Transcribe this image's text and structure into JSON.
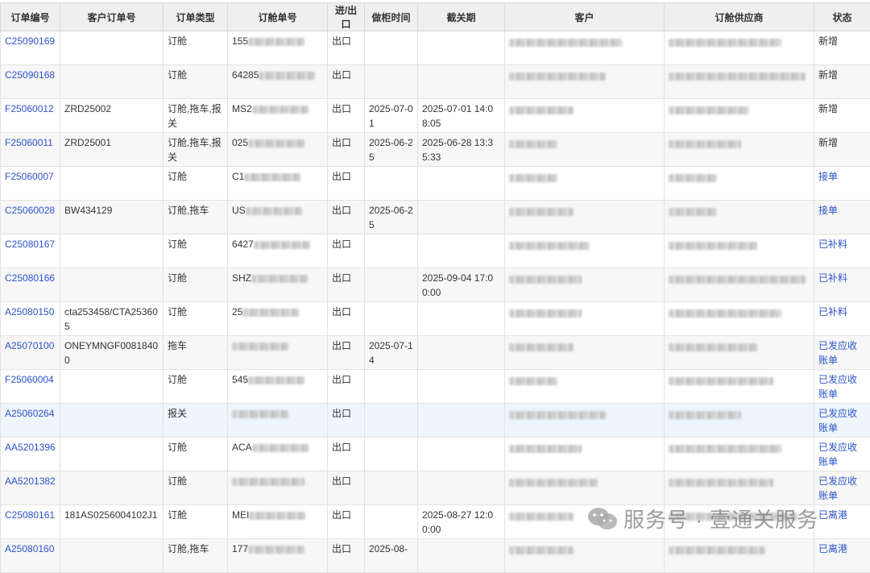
{
  "headers": [
    "订单编号",
    "客户订单号",
    "订单类型",
    "订舱单号",
    "进/出口",
    "做柜时间",
    "截关期",
    "客户",
    "订舱供应商",
    "状态"
  ],
  "rows": [
    {
      "id": "C25090169",
      "cust": "",
      "type": "订舱",
      "bk": "155",
      "dir": "出口",
      "load": "",
      "cut": "",
      "status": "新增",
      "status_color": "plain"
    },
    {
      "id": "C25090168",
      "cust": "",
      "type": "订舱",
      "bk": "64285",
      "dir": "出口",
      "load": "",
      "cut": "",
      "status": "新增",
      "status_color": "plain"
    },
    {
      "id": "F25060012",
      "cust": "ZRD25002",
      "type": "订舱,拖车,报关",
      "bk": "MS2",
      "dir": "出口",
      "load": "2025-07-01",
      "cut": "2025-07-01 14:08:05",
      "status": "新增",
      "status_color": "plain"
    },
    {
      "id": "F25060011",
      "cust": "ZRD25001",
      "type": "订舱,拖车,报关",
      "bk": "025",
      "dir": "出口",
      "load": "2025-06-25",
      "cut": "2025-06-28 13:35:33",
      "status": "新增",
      "status_color": "plain"
    },
    {
      "id": "F25060007",
      "cust": "",
      "type": "订舱",
      "bk": "C1",
      "dir": "出口",
      "load": "",
      "cut": "",
      "status": "接单",
      "status_color": "blue"
    },
    {
      "id": "C25060028",
      "cust": "BW434129",
      "type": "订舱,拖车",
      "bk": "US",
      "dir": "出口",
      "load": "2025-06-25",
      "cut": "",
      "status": "接单",
      "status_color": "blue"
    },
    {
      "id": "C25080167",
      "cust": "",
      "type": "订舱",
      "bk": "6427",
      "dir": "出口",
      "load": "",
      "cut": "",
      "status": "已补料",
      "status_color": "blue"
    },
    {
      "id": "C25080166",
      "cust": "",
      "type": "订舱",
      "bk": "SHZ",
      "dir": "出口",
      "load": "",
      "cut": "2025-09-04 17:00:00",
      "status": "已补料",
      "status_color": "blue"
    },
    {
      "id": "A25080150",
      "cust": "cta253458/CTA253605",
      "type": "订舱",
      "bk": "25",
      "dir": "出口",
      "load": "",
      "cut": "",
      "status": "已补料",
      "status_color": "blue"
    },
    {
      "id": "A25070100",
      "cust": "ONEYMNGF00818400",
      "type": "拖车",
      "bk": "",
      "dir": "出口",
      "load": "2025-07-14",
      "cut": "",
      "status": "已发应收账单",
      "status_color": "blue"
    },
    {
      "id": "F25060004",
      "cust": "",
      "type": "订舱",
      "bk": "545",
      "dir": "出口",
      "load": "",
      "cut": "",
      "status": "已发应收账单",
      "status_color": "blue"
    },
    {
      "id": "A25060264",
      "cust": "",
      "type": "报关",
      "bk": "",
      "dir": "出口",
      "load": "",
      "cut": "",
      "status": "已发应收账单",
      "status_color": "blue"
    },
    {
      "id": "AA5201396",
      "cust": "",
      "type": "订舱",
      "bk": "ACA",
      "dir": "出口",
      "load": "",
      "cut": "",
      "status": "已发应收账单",
      "status_color": "blue"
    },
    {
      "id": "AA5201382",
      "cust": "",
      "type": "订舱",
      "bk": "",
      "dir": "出口",
      "load": "",
      "cut": "",
      "status": "已发应收账单",
      "status_color": "blue"
    },
    {
      "id": "C25080161",
      "cust": "181AS0256004102J1",
      "type": "订舱",
      "bk": "MEI",
      "dir": "出口",
      "load": "",
      "cut": "2025-08-27 12:00:00",
      "status": "已离港",
      "status_color": "blue"
    },
    {
      "id": "A25080160",
      "cust": "",
      "type": "订舱,拖车",
      "bk": "177",
      "dir": "出口",
      "load": "2025-08-",
      "cut": "",
      "status": "已离港",
      "status_color": "blue"
    }
  ],
  "watermark": {
    "text": "服务号 · 壹通关服务"
  },
  "colors": {
    "link": "#2b53c9",
    "header_bg": "#efefef",
    "row_alt": "#f7f7f7",
    "row_highlight": "#eef5fb"
  }
}
